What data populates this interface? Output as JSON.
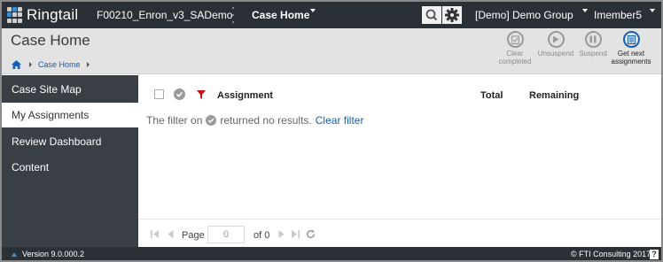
{
  "app": {
    "brand": "Ringtail",
    "case_name": "F00210_Enron_v3_SADemo",
    "nav_menu": "Case Home",
    "group_menu": "[Demo] Demo Group",
    "user_menu": "Imember5"
  },
  "header": {
    "title": "Case Home",
    "breadcrumb": [
      "Case Home"
    ],
    "actions": [
      {
        "label_line1": "Clear",
        "label_line2": "completed",
        "icon": "clipboard-check-icon",
        "enabled": false
      },
      {
        "label_line1": "Unsuspend",
        "label_line2": "",
        "icon": "play-icon",
        "enabled": false
      },
      {
        "label_line1": "Suspend",
        "label_line2": "",
        "icon": "pause-icon",
        "enabled": false
      },
      {
        "label_line1": "Get next",
        "label_line2": "assignments",
        "icon": "list-icon",
        "enabled": true
      }
    ]
  },
  "sidebar": {
    "items": [
      {
        "label": "Case Site Map",
        "active": false
      },
      {
        "label": "My Assignments",
        "active": true
      },
      {
        "label": "Review Dashboard",
        "active": false
      },
      {
        "label": "Content",
        "active": false
      }
    ]
  },
  "table": {
    "columns": [
      "Assignment",
      "Total",
      "Remaining"
    ],
    "empty_prefix": "The filter on",
    "empty_suffix": "returned no results.",
    "clear_filter": "Clear filter"
  },
  "pager": {
    "page_label": "Page",
    "page_value": "0",
    "of_label": "of 0"
  },
  "footer": {
    "version": "Version 9.0.000.2",
    "copyright": "© FTI Consulting 2017",
    "help": "?"
  },
  "colors": {
    "topbar": "#2b2f36",
    "sidebar": "#3a3e45",
    "accent": "#1a5fb4",
    "filter": "#cc1111"
  }
}
